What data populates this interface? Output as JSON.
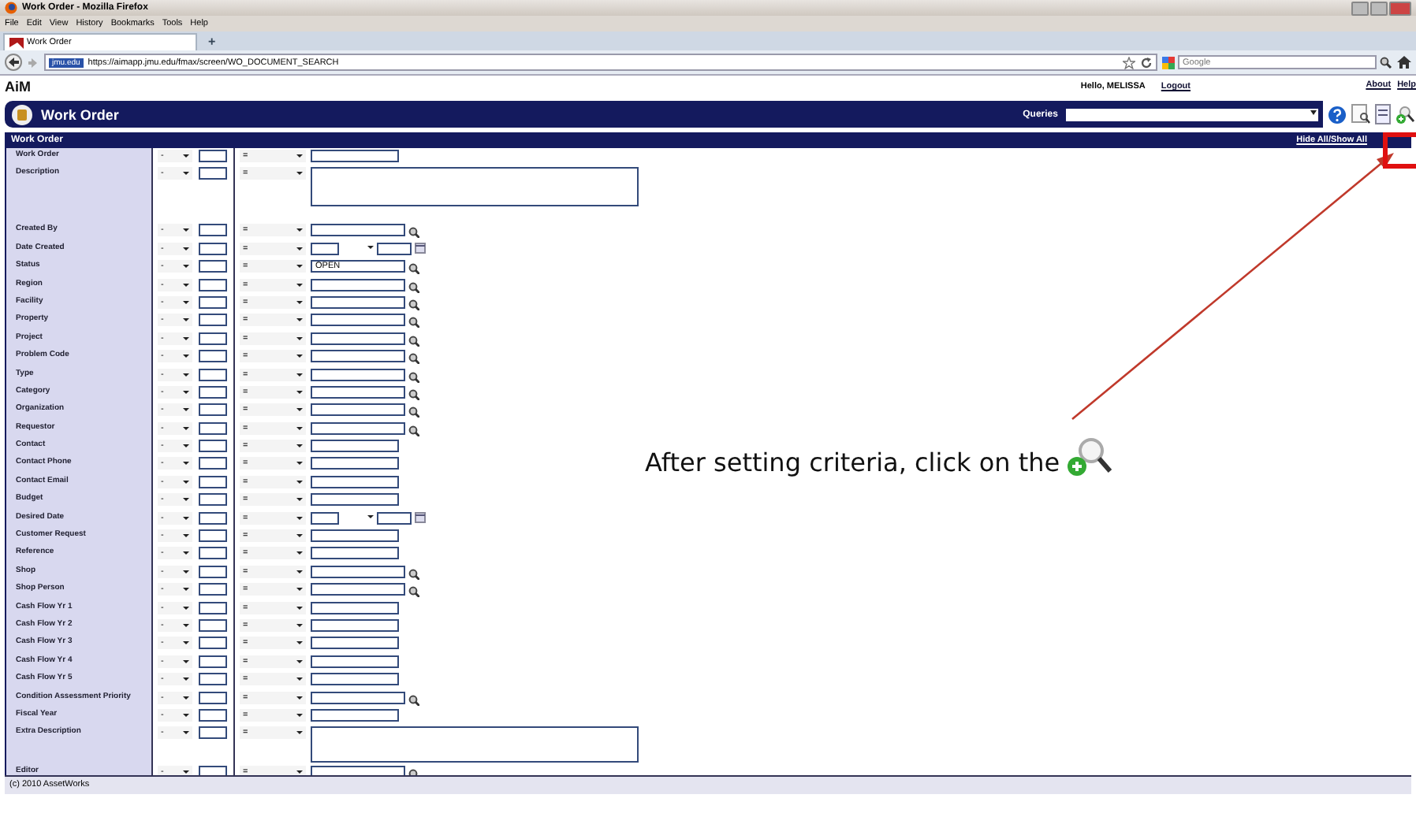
{
  "window": {
    "title": "Work Order - Mozilla Firefox"
  },
  "menu": [
    "File",
    "Edit",
    "View",
    "History",
    "Bookmarks",
    "Tools",
    "Help"
  ],
  "tabs": [
    {
      "label": "Work Order",
      "selected": true
    }
  ],
  "new_tab": "+",
  "address": {
    "site": "jmu.edu",
    "url": "https://aimapp.jmu.edu/fmax/screen/WO_DOCUMENT_SEARCH"
  },
  "search": {
    "placeholder": "Google"
  },
  "app": {
    "logo": "AiM",
    "greeting": "Hello, MELISSA",
    "logout": "Logout",
    "links": [
      "About",
      "Help"
    ],
    "header": "Work Order",
    "queries_label": "Queries",
    "section": "Work Order",
    "toggle": "Hide All/Show All",
    "footer": "(c) 2010 AssetWorks"
  },
  "rows": [
    {
      "label": "Work Order",
      "kind": "text",
      "op1": "-",
      "op2": "="
    },
    {
      "label": "Description",
      "kind": "textarea",
      "op1": "-",
      "op2": "="
    },
    {
      "label": "Created By",
      "kind": "lookup",
      "op1": "-",
      "op2": "="
    },
    {
      "label": "Date Created",
      "kind": "date",
      "op1": "-",
      "op2": "="
    },
    {
      "label": "Status",
      "kind": "lookup",
      "op1": "-",
      "op2": "=",
      "value": "OPEN"
    },
    {
      "label": "Region",
      "kind": "lookup",
      "op1": "-",
      "op2": "="
    },
    {
      "label": "Facility",
      "kind": "lookup",
      "op1": "-",
      "op2": "="
    },
    {
      "label": "Property",
      "kind": "lookup",
      "op1": "-",
      "op2": "="
    },
    {
      "label": "Project",
      "kind": "lookup",
      "op1": "-",
      "op2": "="
    },
    {
      "label": "Problem Code",
      "kind": "lookup",
      "op1": "-",
      "op2": "="
    },
    {
      "label": "Type",
      "kind": "lookup",
      "op1": "-",
      "op2": "="
    },
    {
      "label": "Category",
      "kind": "lookup",
      "op1": "-",
      "op2": "="
    },
    {
      "label": "Organization",
      "kind": "lookup",
      "op1": "-",
      "op2": "="
    },
    {
      "label": "Requestor",
      "kind": "lookup",
      "op1": "-",
      "op2": "="
    },
    {
      "label": "Contact",
      "kind": "text",
      "op1": "-",
      "op2": "="
    },
    {
      "label": "Contact Phone",
      "kind": "text",
      "op1": "-",
      "op2": "="
    },
    {
      "label": "Contact Email",
      "kind": "text",
      "op1": "-",
      "op2": "="
    },
    {
      "label": "Budget",
      "kind": "text",
      "op1": "-",
      "op2": "="
    },
    {
      "label": "Desired Date",
      "kind": "date",
      "op1": "-",
      "op2": "="
    },
    {
      "label": "Customer Request",
      "kind": "text",
      "op1": "-",
      "op2": "="
    },
    {
      "label": "Reference",
      "kind": "text",
      "op1": "-",
      "op2": "="
    },
    {
      "label": "Shop",
      "kind": "lookup",
      "op1": "-",
      "op2": "="
    },
    {
      "label": "Shop Person",
      "kind": "lookup",
      "op1": "-",
      "op2": "="
    },
    {
      "label": "Cash Flow Yr 1",
      "kind": "text",
      "op1": "-",
      "op2": "="
    },
    {
      "label": "Cash Flow Yr 2",
      "kind": "text",
      "op1": "-",
      "op2": "="
    },
    {
      "label": "Cash Flow Yr 3",
      "kind": "text",
      "op1": "-",
      "op2": "="
    },
    {
      "label": "Cash Flow Yr 4",
      "kind": "text",
      "op1": "-",
      "op2": "="
    },
    {
      "label": "Cash Flow Yr 5",
      "kind": "text",
      "op1": "-",
      "op2": "="
    },
    {
      "label": "Condition Assessment Priority",
      "kind": "lookup",
      "op1": "-",
      "op2": "="
    },
    {
      "label": "Fiscal Year",
      "kind": "text",
      "op1": "-",
      "op2": "="
    },
    {
      "label": "Extra Description",
      "kind": "textarea",
      "op1": "-",
      "op2": "="
    },
    {
      "label": "Editor",
      "kind": "lookup",
      "op1": "-",
      "op2": "="
    }
  ],
  "annotation": {
    "text": "After setting criteria, click on the"
  }
}
